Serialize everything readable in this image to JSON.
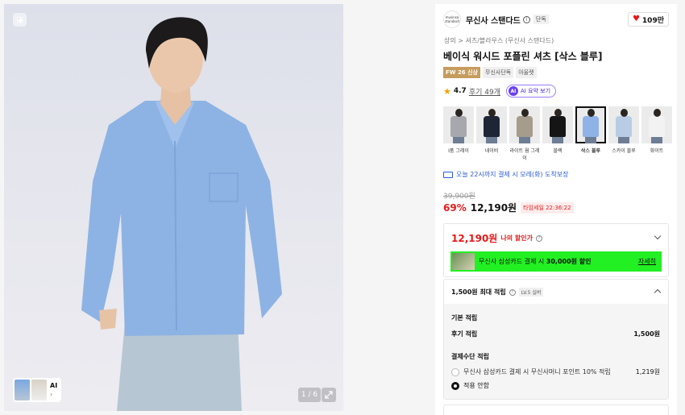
{
  "gallery": {
    "counter": "1 / 6",
    "ai_label": "AI",
    "ai_arrow": "›"
  },
  "brand": {
    "logo_text": "musinsa standard",
    "name": "무신사 스탠다드",
    "exclusive_badge": "단독",
    "likes": "109만"
  },
  "breadcrumb": "상의 > 셔츠/블라우스 (무신사 스탠다드)",
  "product": {
    "title": "베이식 워시드 포플린 셔츠 [삭스 블루]",
    "tags": [
      "FW 26 신상",
      "무신사단독",
      "아울렛"
    ]
  },
  "rating": {
    "score": "4.7",
    "reviews": "후기 49개",
    "ai_summary": "AI 요약 보기",
    "ai_dot": "AI"
  },
  "colors": [
    {
      "label": "I품 그레이",
      "color": "#a6a8ad"
    },
    {
      "label": "네이비",
      "color": "#1e2636"
    },
    {
      "label": "라이트 웜 그레이",
      "color": "#a59c8b"
    },
    {
      "label": "블랙",
      "color": "#151515"
    },
    {
      "label": "삭스 블루",
      "color": "#8fb3e6"
    },
    {
      "label": "스카이 블루",
      "color": "#b8cce6"
    },
    {
      "label": "화이트",
      "color": "#f2f2f2"
    }
  ],
  "selected_color_index": 4,
  "delivery": "오늘 22시까지 결제 시 모레(화) 도착보장",
  "pricing": {
    "original": "39,900원",
    "discount": "69%",
    "price": "12,190원",
    "timesale": "타임세일 22:36:22"
  },
  "my_discount": {
    "amount": "12,190원",
    "label": "나의 할인가",
    "card_text_pre": "무신사 삼성카드 결제 시 ",
    "card_text_bold": "30,000원 할인",
    "card_link": "자세히"
  },
  "points": {
    "max": "1,500원 최대 적립",
    "level": "LV.5 실버",
    "basic_header": "기본 적립",
    "review_label": "후기 적립",
    "review_value": "1,500원",
    "payment_header": "결제수단 적립",
    "card_label": "무신사 삼성카드 결제 시 무신사머니 포인트 10% 적립",
    "card_value": "1,219원",
    "none_label": "적용 안함"
  },
  "accent": {
    "red": "#e51a1a",
    "green_banner": "#22f022",
    "ai_purple": "#6a40f5",
    "delivery_blue": "#2a5bd7"
  }
}
